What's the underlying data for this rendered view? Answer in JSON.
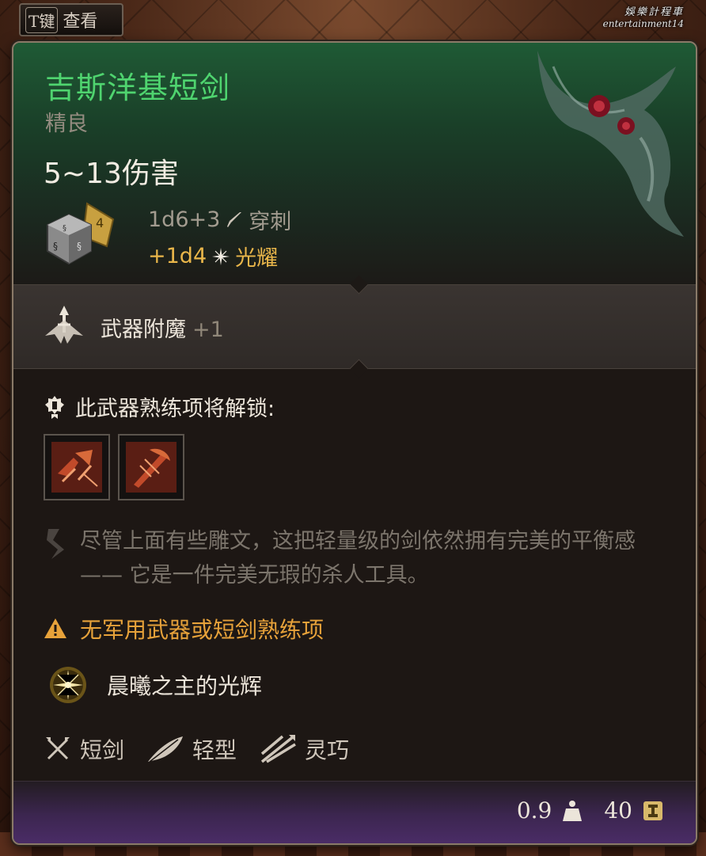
{
  "hint": {
    "key": "T键",
    "label": "查看"
  },
  "watermark": {
    "line1": "娛樂計程車",
    "line2": "entertainment14"
  },
  "item": {
    "name": "吉斯洋基短剑",
    "rarity": "精良",
    "damage_total": "5~13伤害",
    "damage_base": "1d6+3",
    "damage_base_type": "穿刺",
    "damage_bonus": "+1d4",
    "damage_bonus_type": "光耀"
  },
  "enchant": {
    "label": "武器附魔",
    "value": "+1"
  },
  "proficiency": {
    "title": "此武器熟练项将解锁:"
  },
  "description": "尽管上面有些雕文，这把轻量级的剑依然拥有完美的平衡感 —— 它是一件完美无瑕的杀人工具。",
  "warning": "无军用武器或短剑熟练项",
  "blessing": "晨曦之主的光辉",
  "properties": [
    "短剑",
    "轻型",
    "灵巧"
  ],
  "footer": {
    "weight": "0.9",
    "value": "40"
  },
  "colors": {
    "title": "#4fd46f",
    "bonus_damage": "#e9b64a",
    "warning": "#e7a23a",
    "header_green": "#1f5a35",
    "footer_purple": "#4a2c66"
  },
  "icons": {
    "dice": "dice-icon",
    "piercing": "piercing-icon",
    "radiant": "radiant-icon",
    "enchant": "weapon-enchant-icon",
    "proficiency": "proficiency-icon",
    "actions": [
      "weapon-action-1-icon",
      "weapon-action-2-icon"
    ],
    "quote": "description-quote-icon",
    "warning": "warning-icon",
    "blessing": "radiance-sun-icon",
    "properties": [
      "shortsword-icon",
      "light-feather-icon",
      "finesse-icon"
    ],
    "weight": "weight-icon",
    "gold": "gold-icon"
  }
}
